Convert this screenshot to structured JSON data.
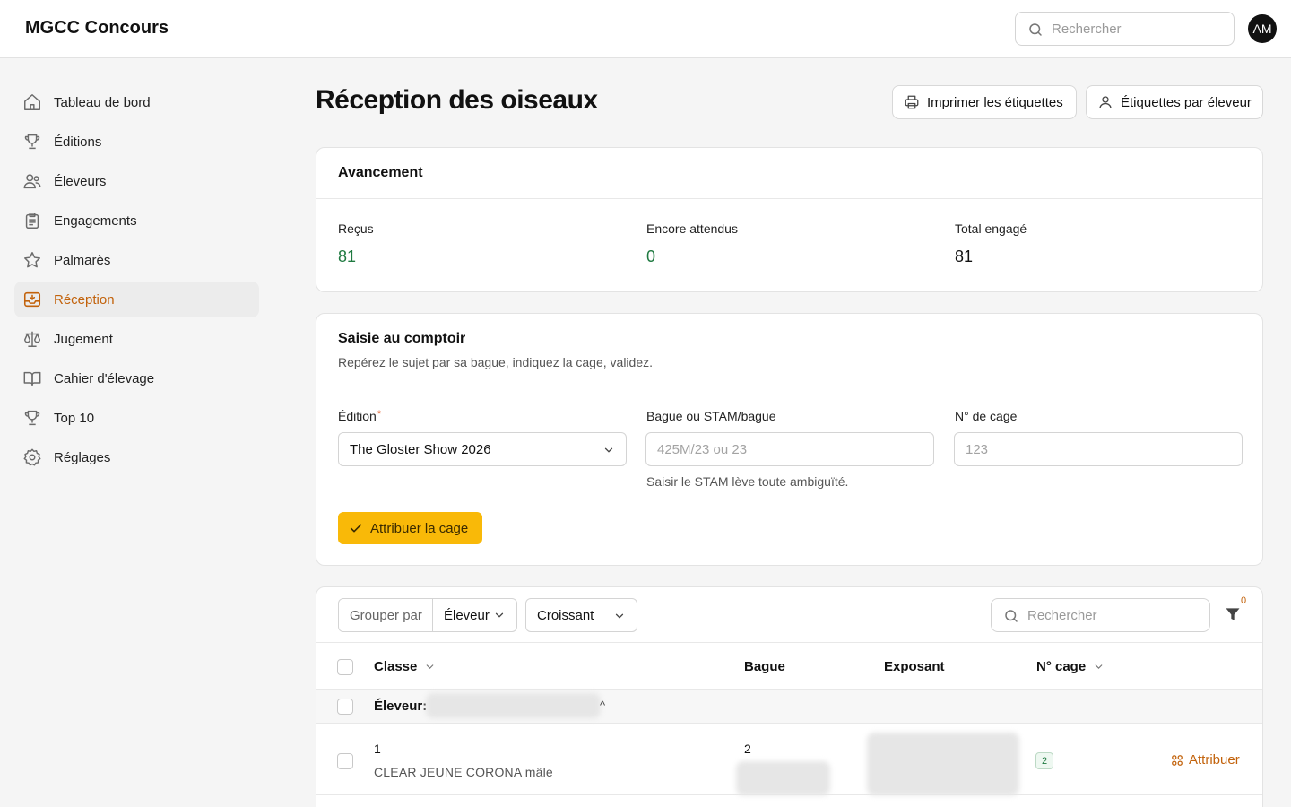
{
  "app": {
    "title": "MGCC Concours"
  },
  "topbar": {
    "search_placeholder": "Rechercher",
    "avatar_initials": "AM"
  },
  "sidebar": {
    "items": [
      {
        "label": "Tableau de bord",
        "icon": "home-icon",
        "active": false
      },
      {
        "label": "Éditions",
        "icon": "trophy-icon",
        "active": false
      },
      {
        "label": "Éleveurs",
        "icon": "users-icon",
        "active": false
      },
      {
        "label": "Engagements",
        "icon": "clipboard-icon",
        "active": false
      },
      {
        "label": "Palmarès",
        "icon": "star-icon",
        "active": false
      },
      {
        "label": "Réception",
        "icon": "inbox-icon",
        "active": true
      },
      {
        "label": "Jugement",
        "icon": "scale-icon",
        "active": false
      },
      {
        "label": "Cahier d'élevage",
        "icon": "book-icon",
        "active": false
      },
      {
        "label": "Top 10",
        "icon": "trophy-icon",
        "active": false
      },
      {
        "label": "Réglages",
        "icon": "gear-icon",
        "active": false
      }
    ]
  },
  "page": {
    "title": "Réception des oiseaux",
    "print_labels": "Imprimer les étiquettes",
    "labels_by_breeder": "Étiquettes par éleveur"
  },
  "progress": {
    "title": "Avancement",
    "received_label": "Reçus",
    "received_value": "81",
    "pending_label": "Encore attendus",
    "pending_value": "0",
    "total_label": "Total engagé",
    "total_value": "81",
    "accent_color": "#1f7a41"
  },
  "counter": {
    "title": "Saisie au comptoir",
    "subtitle": "Repérez le sujet par sa bague, indiquez la cage, validez.",
    "edition_label": "Édition",
    "edition_required": "*",
    "edition_value": "The Gloster Show 2026",
    "ring_label": "Bague ou STAM/bague",
    "ring_placeholder": "425M/23 ou 23",
    "ring_help": "Saisir le STAM lève toute ambiguïté.",
    "cage_label": "N° de cage",
    "cage_placeholder": "123",
    "assign_button": "Attribuer la cage",
    "button_color": "#f9b908"
  },
  "table": {
    "group_by_label": "Grouper par",
    "group_by_value": "Éleveur",
    "sort_value": "Croissant",
    "search_placeholder": "Rechercher",
    "filter_count": "0",
    "columns": {
      "class": "Classe",
      "ring": "Bague",
      "exhibitor": "Exposant",
      "cage": "N° cage"
    },
    "group_row_label": "Éleveur:",
    "group_row_toggle": "^",
    "rows": [
      {
        "class_num": "1",
        "class_desc": "CLEAR JEUNE CORONA mâle",
        "ring": "2",
        "cage": "2",
        "action": "Attribuer"
      }
    ]
  }
}
